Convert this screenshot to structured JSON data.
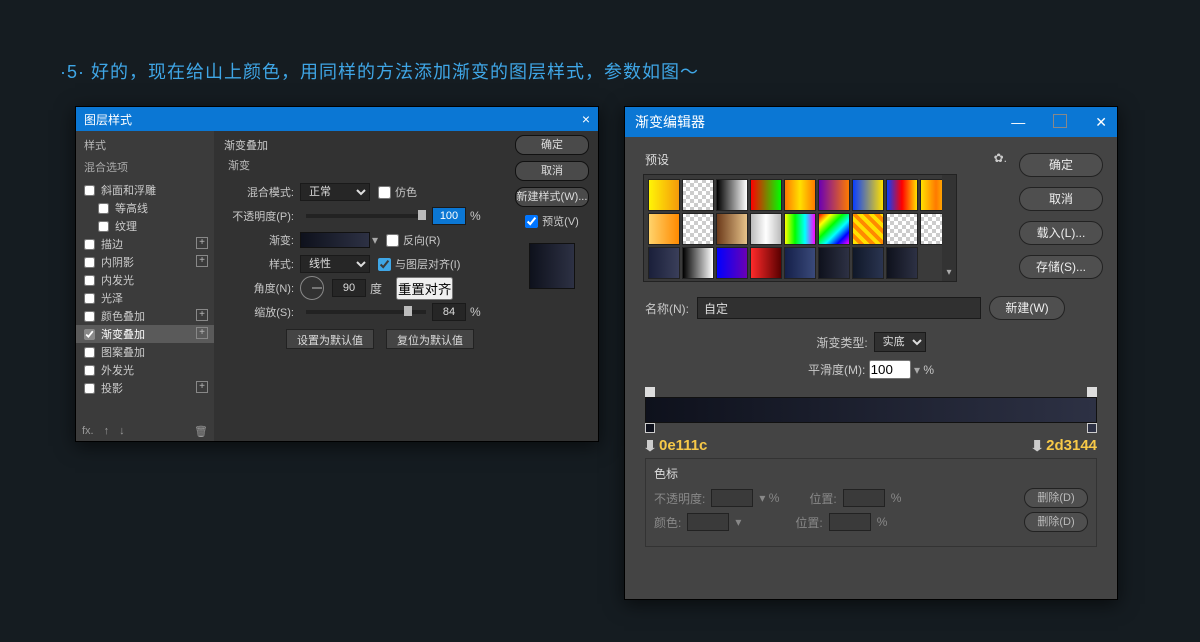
{
  "caption": "·5· 好的，现在给山上颜色，用同样的方法添加渐变的图层样式，参数如图～",
  "layerStyle": {
    "title": "图层样式",
    "side": {
      "styles": "样式",
      "blend": "混合选项",
      "bevel": "斜面和浮雕",
      "contour": "等高线",
      "texture": "纹理",
      "stroke": "描边",
      "innerShadow": "内阴影",
      "innerGlow": "内发光",
      "satin": "光泽",
      "colorOverlay": "颜色叠加",
      "gradOverlay": "渐变叠加",
      "patternOverlay": "图案叠加",
      "outerGlow": "外发光",
      "dropShadow": "投影"
    },
    "main": {
      "sectionTitle": "渐变叠加",
      "subTitle": "渐变",
      "blendMode": "混合模式:",
      "blendModeVal": "正常",
      "dither": "仿色",
      "opacity": "不透明度(P):",
      "opacityVal": "100",
      "gradient": "渐变:",
      "reverse": "反向(R)",
      "style": "样式:",
      "styleVal": "线性",
      "alignLayer": "与图层对齐(I)",
      "angle": "角度(N):",
      "angleVal": "90",
      "angleUnit": "度",
      "resetAlign": "重置对齐",
      "scale": "缩放(S):",
      "scaleVal": "84",
      "setDefault": "设置为默认值",
      "resetDefault": "复位为默认值"
    },
    "right": {
      "ok": "确定",
      "cancel": "取消",
      "newStyle": "新建样式(W)...",
      "preview": "预览(V)"
    }
  },
  "gradientEditor": {
    "title": "渐变编辑器",
    "presets": "预设",
    "ok": "确定",
    "cancel": "取消",
    "load": "载入(L)...",
    "save": "存储(S)...",
    "nameLabel": "名称(N):",
    "nameVal": "自定",
    "new": "新建(W)",
    "typeLabel": "渐变类型:",
    "typeVal": "实底",
    "smoothLabel": "平滑度(M):",
    "smoothVal": "100",
    "hexLeft": "0e111c",
    "hexRight": "2d3144",
    "stops": {
      "title": "色标",
      "opacity": "不透明度:",
      "position": "位置:",
      "delete": "删除(D)",
      "color": "颜色:"
    },
    "swatches": [
      "linear-gradient(90deg,#fff407,#f59a0a)",
      "repeating-conic-gradient(#ccc 0 25%,#fff 0 50%) 50%/8px 8px",
      "linear-gradient(90deg,#000,#fff)",
      "linear-gradient(90deg,#f00,#0f0)",
      "linear-gradient(90deg,#ff7a00,#ffe000,#ff7a00)",
      "linear-gradient(90deg,#6b00b3,#ff7a00)",
      "linear-gradient(90deg,#0a3eff,#ffe000)",
      "linear-gradient(90deg,#0a3eff,#ff0000,#ffe000)",
      "linear-gradient(90deg,#ffe000,#ff7a00,#ffe000)",
      "linear-gradient(90deg,#ffd36b,#ff8a00)",
      "repeating-conic-gradient(#ccc 0 25%,#fff 0 50%) 50%/8px 8px",
      "linear-gradient(90deg,#6b3a1a,#e7c38a)",
      "linear-gradient(90deg,#bbb,#fff,#bbb)",
      "linear-gradient(90deg,#ff0,#0f0,#0ff,#f0f)",
      "linear-gradient(135deg,#f00,#ff0,#0f0,#0ff,#00f,#f0f)",
      "repeating-linear-gradient(45deg,#ffe000 0 4px,#ff8a00 4px 8px)",
      "repeating-conic-gradient(#ccc 0 25%,#fff 0 50%) 50%/8px 8px",
      "repeating-conic-gradient(#ccc 0 25%,#fff 0 50%) 50%/8px 8px",
      "linear-gradient(90deg,#1a1f3a,#3a3f5a)",
      "linear-gradient(90deg,#000,#fff)",
      "linear-gradient(90deg,#0000ff,#6b00b3)",
      "linear-gradient(90deg,#ff2a2a,#5a0000)",
      "linear-gradient(90deg,#15204a,#3a4a7a)",
      "linear-gradient(90deg,#0e111c,#2d3144)",
      "linear-gradient(90deg,#101828,#2a3450)",
      "linear-gradient(90deg,#0e111c,#2d3144)"
    ]
  }
}
